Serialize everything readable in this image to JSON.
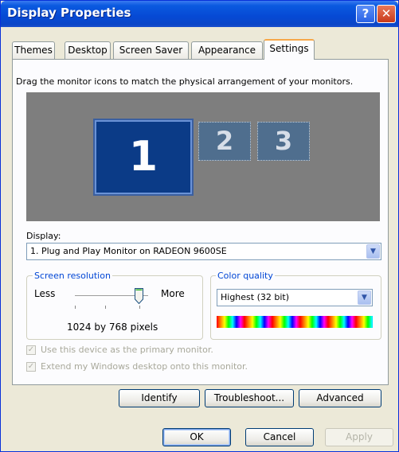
{
  "window": {
    "title": "Display Properties",
    "help_glyph": "?",
    "close_glyph": "✕"
  },
  "tabs": [
    {
      "label": "Themes"
    },
    {
      "label": "Desktop"
    },
    {
      "label": "Screen Saver"
    },
    {
      "label": "Appearance"
    },
    {
      "label": "Settings",
      "active": true
    }
  ],
  "instruction": "Drag the monitor icons to match the physical arrangement of your monitors.",
  "monitors": [
    {
      "label": "1",
      "selected": true
    },
    {
      "label": "2"
    },
    {
      "label": "3"
    }
  ],
  "display": {
    "label": "Display:",
    "value": "1. Plug and Play Monitor on RADEON 9600SE"
  },
  "resolution": {
    "title": "Screen resolution",
    "less": "Less",
    "more": "More",
    "value": "1024 by 768 pixels",
    "slider_level": 0.82
  },
  "color_quality": {
    "title": "Color quality",
    "value": "Highest (32 bit)"
  },
  "options": {
    "primary_label": "Use this device as the primary monitor.",
    "extend_label": "Extend my Windows desktop onto this monitor.",
    "check_glyph": "✓"
  },
  "buttons": {
    "identify": "Identify",
    "troubleshoot": "Troubleshoot...",
    "advanced": "Advanced",
    "ok": "OK",
    "cancel": "Cancel",
    "apply": "Apply"
  },
  "icons": {
    "dropdown_arrow": "▼"
  },
  "colors": {
    "titlebar": "#0649d4",
    "selected_monitor": "#0b3b87",
    "inactive_monitor": "#4f6e8e",
    "group_title": "#0046d5"
  }
}
